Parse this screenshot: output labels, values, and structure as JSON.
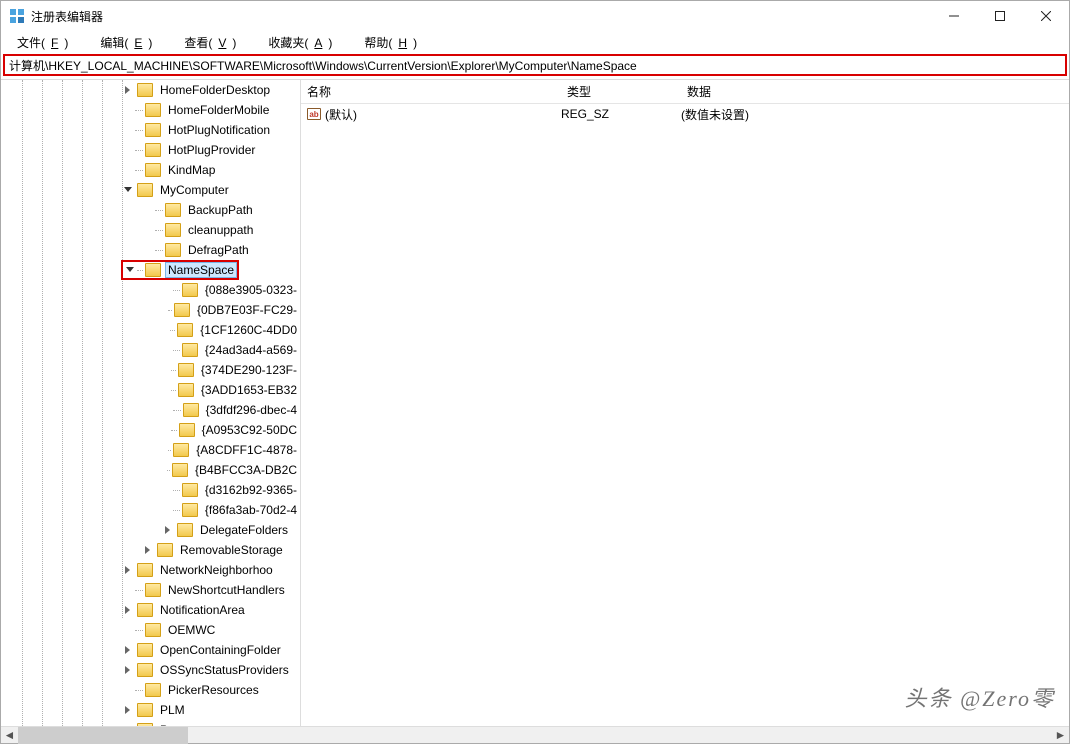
{
  "title": "注册表编辑器",
  "menu": {
    "file": "文件(",
    "file_u": "F",
    "edit": "编辑(",
    "edit_u": "E",
    "view": "查看(",
    "view_u": "V",
    "fav": "收藏夹(",
    "fav_u": "A",
    "help": "帮助(",
    "help_u": "H",
    "close": ")"
  },
  "address": "计算机\\HKEY_LOCAL_MACHINE\\SOFTWARE\\Microsoft\\Windows\\CurrentVersion\\Explorer\\MyComputer\\NameSpace",
  "columns": {
    "name": "名称",
    "type": "类型",
    "data": "数据"
  },
  "row": {
    "name": "(默认)",
    "type": "REG_SZ",
    "data": "(数值未设置)"
  },
  "watermark": "头条 @Zero零",
  "tree_top": [
    "HomeFolderDesktop",
    "HomeFolderMobile",
    "HotPlugNotification",
    "HotPlugProvider",
    "KindMap"
  ],
  "mycomputer": "MyComputer",
  "mc_children": [
    "BackupPath",
    "cleanuppath",
    "DefragPath"
  ],
  "namespace": "NameSpace",
  "ns_children": [
    "{088e3905-0323-",
    "{0DB7E03F-FC29-",
    "{1CF1260C-4DD0",
    "{24ad3ad4-a569-",
    "{374DE290-123F-",
    "{3ADD1653-EB32",
    "{3dfdf296-dbec-4",
    "{A0953C92-50DC",
    "{A8CDFF1C-4878-",
    "{B4BFCC3A-DB2C",
    "{d3162b92-9365-",
    "{f86fa3ab-70d2-4",
    "DelegateFolders"
  ],
  "tree_mid": [
    "RemovableStorage"
  ],
  "tree_bottom": [
    "NetworkNeighborhoo",
    "NewShortcutHandlers",
    "NotificationArea",
    "OEMWC",
    "OpenContainingFolder",
    "OSSyncStatusProviders",
    "PickerResources",
    "PLM",
    "Power"
  ]
}
